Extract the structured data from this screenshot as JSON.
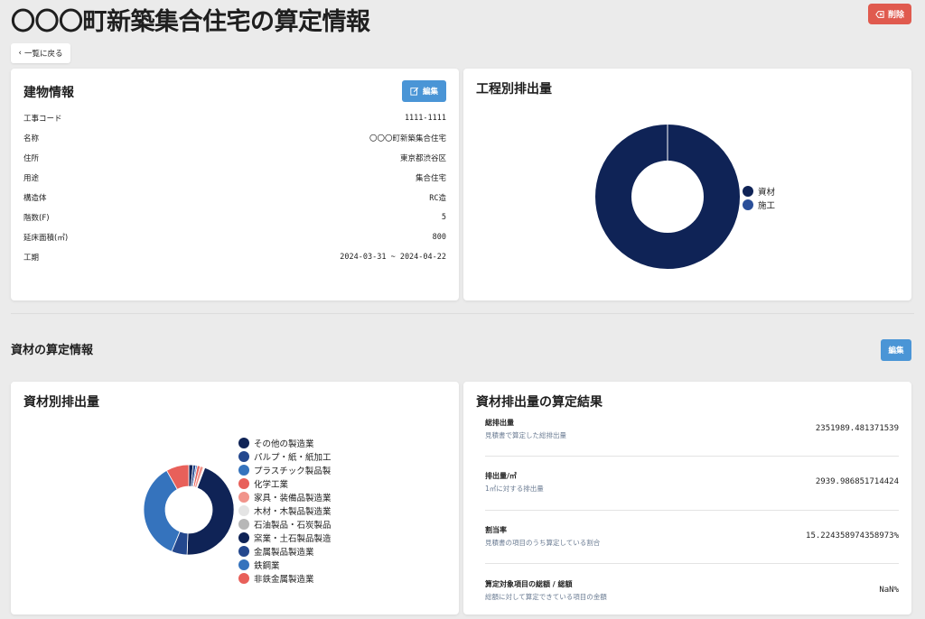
{
  "header": {
    "title": "〇〇〇町新築集合住宅の算定情報",
    "delete_label": "削除",
    "back_label": "一覧に戻る"
  },
  "building": {
    "title": "建物情報",
    "edit_label": "編集",
    "rows": [
      {
        "label": "工事コード",
        "value": "1111-1111"
      },
      {
        "label": "名称",
        "value": "〇〇〇町新築集合住宅"
      },
      {
        "label": "住所",
        "value": "東京都渋谷区"
      },
      {
        "label": "用途",
        "value": "集合住宅"
      },
      {
        "label": "構造体",
        "value": "RC造"
      },
      {
        "label": "階数(F)",
        "value": "5"
      },
      {
        "label": "延床面積(㎡)",
        "value": "800"
      },
      {
        "label": "工期",
        "value": "2024-03-31 ~ 2024-04-22"
      }
    ]
  },
  "process_chart": {
    "title": "工程別排出量",
    "legend": [
      {
        "label": "資材",
        "color": "#0f2356"
      },
      {
        "label": "施工",
        "color": "#2a4f99"
      }
    ]
  },
  "materials_section": {
    "title": "資材の算定情報",
    "edit_label": "編集"
  },
  "material_chart": {
    "title": "資材別排出量",
    "legend": [
      {
        "label": "その他の製造業",
        "color": "#0f2356"
      },
      {
        "label": "パルプ・紙・紙加工",
        "color": "#24488e"
      },
      {
        "label": "プラスチック製品製",
        "color": "#3573bd"
      },
      {
        "label": "化学工業",
        "color": "#e8605a"
      },
      {
        "label": "家具・装備品製造業",
        "color": "#f1948b"
      },
      {
        "label": "木材・木製品製造業",
        "color": "#e4e4e4"
      },
      {
        "label": "石油製品・石炭製品",
        "color": "#b7b7b7"
      },
      {
        "label": "窯業・土石製品製造",
        "color": "#0f2356"
      },
      {
        "label": "金属製品製造業",
        "color": "#24488e"
      },
      {
        "label": "鉄鋼業",
        "color": "#3573bd"
      },
      {
        "label": "非鉄金属製造業",
        "color": "#e8605a"
      }
    ]
  },
  "results": {
    "title": "資材排出量の算定結果",
    "rows": [
      {
        "label": "総排出量",
        "sub": "見積書で算定した総排出量",
        "value": "2351989.481371539"
      },
      {
        "label": "排出量/㎡",
        "sub": "1㎡に対する排出量",
        "value": "2939.986851714424"
      },
      {
        "label": "割当率",
        "sub": "見積書の項目のうち算定している割合",
        "value": "15.224358974358973%"
      },
      {
        "label": "算定対象項目の総額 / 総額",
        "sub": "総額に対して算定できている項目の金額",
        "value": "NaN%"
      }
    ]
  },
  "chart_data": [
    {
      "type": "pie",
      "title": "工程別排出量",
      "categories": [
        "資材",
        "施工"
      ],
      "values": [
        100,
        0
      ],
      "legend": "right"
    },
    {
      "type": "pie",
      "title": "資材別排出量",
      "categories": [
        "その他の製造業",
        "パルプ・紙・紙加工",
        "プラスチック製品製",
        "化学工業",
        "家具・装備品製造業",
        "木材・木製品製造業",
        "石油製品・石炭製品",
        "窯業・土石製品製造",
        "金属製品製造業",
        "鉄鋼業",
        "非鉄金属製造業"
      ],
      "values": [
        1.5,
        1,
        0.5,
        1,
        1.2,
        0.3,
        0.2,
        44,
        5.5,
        35,
        8
      ],
      "legend": "right"
    }
  ]
}
